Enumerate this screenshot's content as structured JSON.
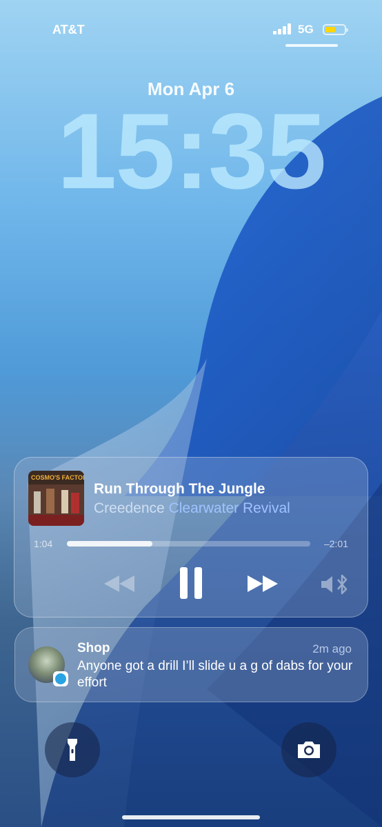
{
  "status_bar": {
    "carrier": "AT&T",
    "network": "5G"
  },
  "lock_screen": {
    "date": "Mon Apr 6",
    "time": "15:35"
  },
  "now_playing": {
    "song_title": "Run Through The Jungle",
    "artist_part1": "Creedence ",
    "artist_part2": "Clearwater Revival",
    "album_art_text": "COSMO'S FACTORY",
    "elapsed": "1:04",
    "remaining": "–2:01",
    "progress": 0.35
  },
  "notification": {
    "app_title": "Shop",
    "time_ago": "2m ago",
    "body": "Anyone got a drill I’ll slide u a g of dabs for your effort",
    "badge_icon": "telegram-icon"
  },
  "quick_actions": {
    "left_icon": "flashlight-icon",
    "right_icon": "camera-icon"
  },
  "colors": {
    "battery": "#ffd60a",
    "artist_highlight": "#9fc3ff"
  }
}
